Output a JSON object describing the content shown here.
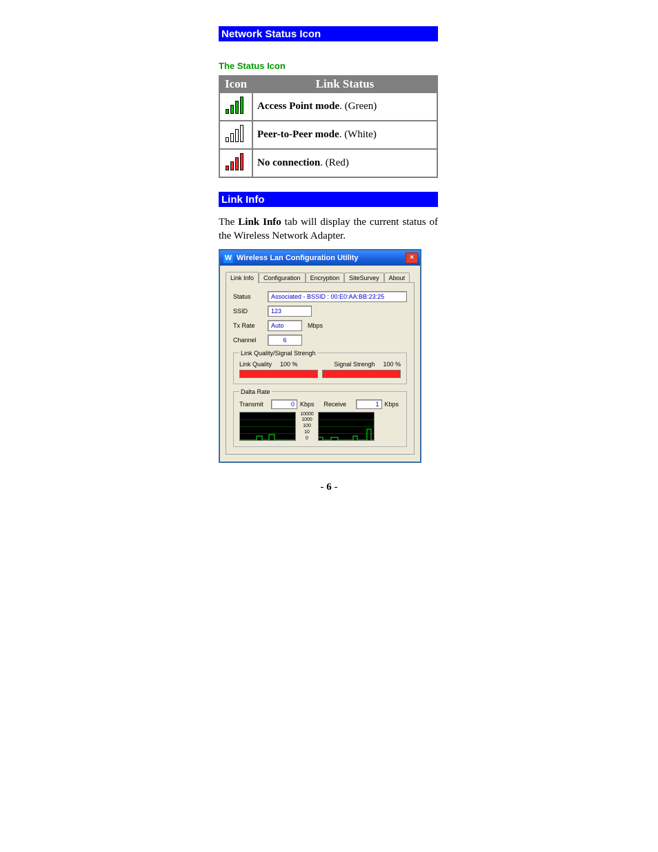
{
  "headers": {
    "network_status_icon": "Network Status Icon",
    "status_icon": "The Status Icon",
    "link_info": "Link Info"
  },
  "status_table": {
    "th_icon": "Icon",
    "th_status": "Link Status",
    "rows": [
      {
        "bold": "Access Point mode",
        "suffix": ". (Green)"
      },
      {
        "bold": "Peer-to-Peer mode",
        "suffix": ". (White)"
      },
      {
        "bold": "No connection",
        "suffix": ". (Red)"
      }
    ]
  },
  "paragraph": {
    "pre": "The ",
    "bold": "Link Info",
    "post": " tab will display the current status of the Wireless Network Adapter."
  },
  "dialog": {
    "app_icon_glyph": "W",
    "title": "Wireless Lan Configuration Utility",
    "close_glyph": "×",
    "tabs": [
      "Link Info",
      "Configuration",
      "Encryption",
      "SiteSurvey",
      "About"
    ],
    "labels": {
      "status": "Status",
      "ssid": "SSID",
      "txrate": "Tx Rate",
      "txrate_unit": "Mbps",
      "channel": "Channel",
      "group_quality": "Link Quality/Signal Strengh",
      "link_quality": "Link Quality",
      "signal_strength": "Signal Strengh",
      "group_datarate": "Dalta Rate",
      "transmit": "Transmit",
      "receive": "Receive",
      "kbps": "Kbps"
    },
    "values": {
      "status": "Associated - BSSID : 00:E0:AA:BB:23:25",
      "ssid": "123",
      "txrate": "Auto",
      "channel": "6",
      "link_quality_pct": "100 %",
      "signal_strength_pct": "100 %",
      "transmit": "0",
      "receive": "1",
      "yscale": [
        "10000",
        "1000",
        "100",
        "10",
        "0"
      ]
    }
  },
  "page_number": {
    "dash1": "- ",
    "num": "6",
    "dash2": " -"
  }
}
